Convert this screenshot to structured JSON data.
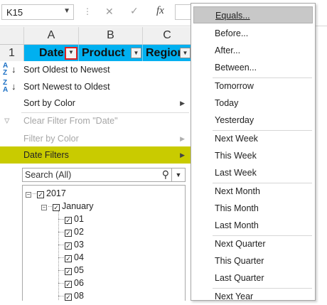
{
  "formula_bar": {
    "name_box": "K15",
    "fx_label": "fx"
  },
  "columns": [
    {
      "letter": "A"
    },
    {
      "letter": "B"
    },
    {
      "letter": "C"
    }
  ],
  "header_row": {
    "row_number": "1",
    "cells": [
      "Date",
      "Product",
      "Region"
    ]
  },
  "filter_menu": {
    "items": [
      {
        "label": "Sort Oldest to Newest",
        "icon": "sort-ascending-icon",
        "enabled": true
      },
      {
        "label": "Sort Newest to Oldest",
        "icon": "sort-descending-icon",
        "enabled": true
      },
      {
        "label": "Sort by Color",
        "icon": "",
        "enabled": true,
        "submenu": true
      },
      {
        "label": "Clear Filter From \"Date\"",
        "icon": "clear-filter-icon",
        "enabled": false
      },
      {
        "label": "Filter by Color",
        "icon": "",
        "enabled": false,
        "submenu": true
      },
      {
        "label": "Date Filters",
        "icon": "",
        "enabled": true,
        "submenu": true,
        "highlighted": true
      }
    ],
    "search_placeholder": "Search (All)",
    "tree": {
      "year": "2017",
      "month": "January",
      "days": [
        "01",
        "02",
        "03",
        "04",
        "05",
        "06",
        "08"
      ]
    }
  },
  "date_filters_submenu": {
    "highlight_color": "#c9cb00",
    "items": [
      {
        "label": "Equals...",
        "selected": true
      },
      {
        "label": "Before...",
        "selected": false
      },
      {
        "label": "After...",
        "selected": false
      },
      {
        "label": "Between...",
        "selected": false
      },
      {
        "label": "Tomorrow",
        "selected": false
      },
      {
        "label": "Today",
        "selected": false
      },
      {
        "label": "Yesterday",
        "selected": false
      },
      {
        "label": "Next Week",
        "selected": false
      },
      {
        "label": "This Week",
        "selected": false
      },
      {
        "label": "Last Week",
        "selected": false
      },
      {
        "label": "Next Month",
        "selected": false
      },
      {
        "label": "This Month",
        "selected": false
      },
      {
        "label": "Last Month",
        "selected": false
      },
      {
        "label": "Next Quarter",
        "selected": false
      },
      {
        "label": "This Quarter",
        "selected": false
      },
      {
        "label": "Last Quarter",
        "selected": false
      },
      {
        "label": "Next Year",
        "selected": false
      }
    ]
  }
}
